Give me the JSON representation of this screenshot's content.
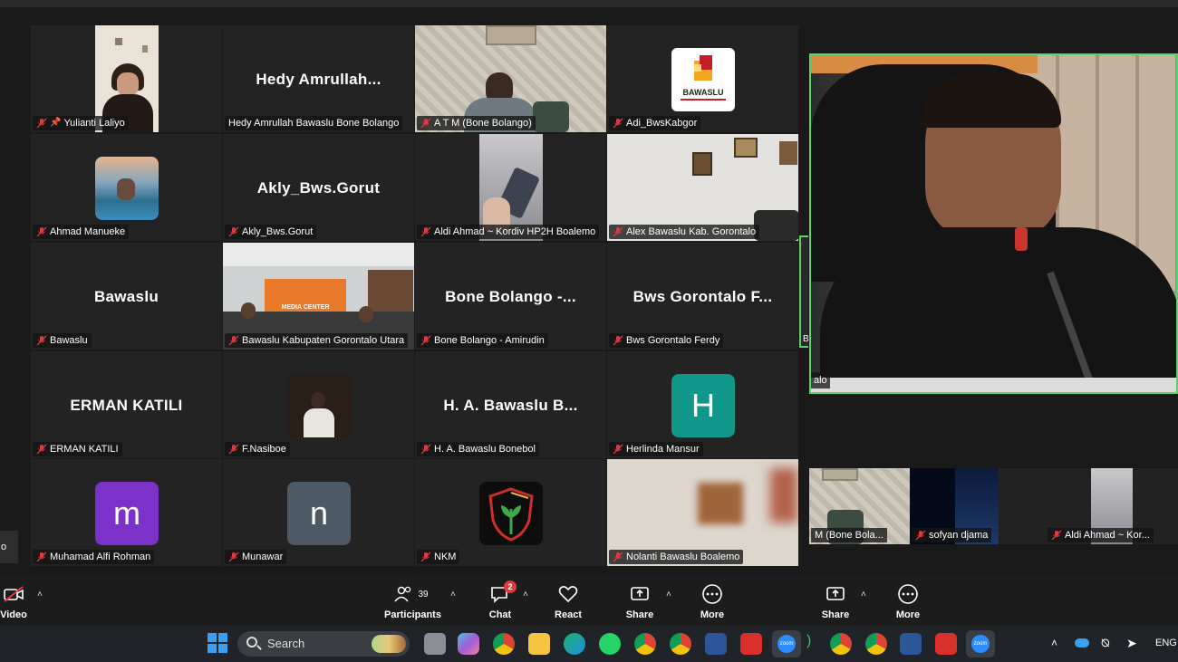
{
  "gallery": {
    "tiles": [
      {
        "name": "Yulianti Laliyo",
        "pinned": true
      },
      {
        "name": "Hedy Amrullah Bawaslu Bone Bolango",
        "big": "Hedy  Amrullah..."
      },
      {
        "name": "A T M  (Bone Bolango)"
      },
      {
        "name": "Adi_BwsKabgor"
      },
      {
        "name": "Ahmad Manueke"
      },
      {
        "name": "Akly_Bws.Gorut",
        "big": "Akly_Bws.Gorut"
      },
      {
        "name": "Aldi Ahmad ~ Kordiv HP2H Boalemo"
      },
      {
        "name": "Alex Bawaslu Kab. Gorontalo"
      },
      {
        "name": "Bawaslu",
        "big": "Bawaslu"
      },
      {
        "name": "Bawaslu Kabupaten Gorontalo Utara"
      },
      {
        "name": "Bone Bolango - Amirudin",
        "big": "Bone  Bolango  -..."
      },
      {
        "name": "Bws Gorontalo Ferdy",
        "big": "Bws  Gorontalo  F..."
      },
      {
        "name": "ERMAN KATILI",
        "big": "ERMAN KATILI"
      },
      {
        "name": "F.Nasiboe"
      },
      {
        "name": "H. A. Bawaslu Bonebol",
        "big": "H.  A.  Bawaslu  B..."
      },
      {
        "name": "Herlinda Mansur",
        "avatar": "H"
      },
      {
        "name": "Muhamad Alfi Rohman",
        "avatar": "m"
      },
      {
        "name": "Munawar",
        "avatar": "n"
      },
      {
        "name": "NKM"
      },
      {
        "name": "Nolanti Bawaslu Boalemo"
      }
    ],
    "logo_text": "BAWASLU",
    "media_center_text": "MEDIA CENTER",
    "left_edge_text": "o"
  },
  "speaker": {
    "edge_label": "B",
    "bottom_label": "alo"
  },
  "strip": [
    {
      "name": "M  (Bone Bola..."
    },
    {
      "name": "sofyan djama"
    },
    {
      "name": "Aldi Ahmad ~ Kor..."
    }
  ],
  "toolbar": {
    "video_label": "Video",
    "participants_label": "Participants",
    "participants_count": "39",
    "chat_label": "Chat",
    "chat_badge": "2",
    "react_label": "React",
    "share_label": "Share",
    "more_label": "More",
    "share2_label": "Share",
    "more2_label": "More"
  },
  "taskbar": {
    "search_placeholder": "Search",
    "lang": "ENG",
    "zoom_text": "zoom"
  },
  "colors": {
    "active_speaker_border": "#5ad36a",
    "mute_red": "#e0393e",
    "avatar_teal": "#11968a",
    "avatar_purple": "#7a32c9",
    "avatar_slate": "#4d5a66"
  }
}
